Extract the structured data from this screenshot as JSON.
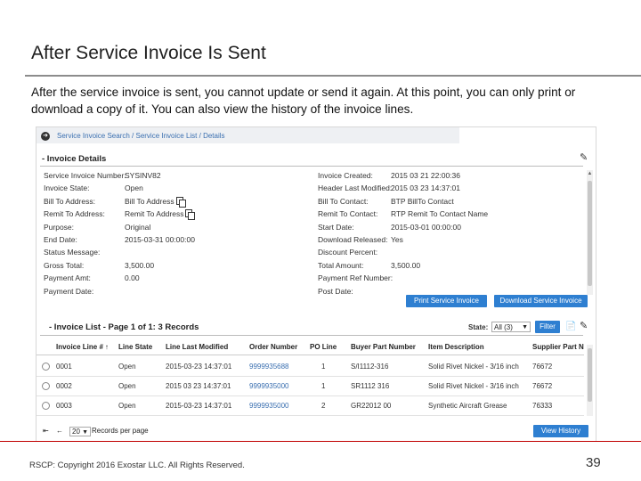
{
  "slide": {
    "title": "After Service Invoice Is Sent",
    "body": "After the service invoice is sent, you cannot update or send it again.  At this point, you can only print or download a copy of it.  You can also view the history of the invoice lines."
  },
  "app": {
    "breadcrumb": "Service Invoice Search / Service Invoice List / Details",
    "details": {
      "title": "- Invoice Details",
      "left": [
        {
          "label": "Service Invoice Number:",
          "value": "SYSINV82"
        },
        {
          "label": "Invoice State:",
          "value": "Open"
        },
        {
          "label": "Bill To Address:",
          "value": "Bill To Address"
        },
        {
          "label": "Remit To Address:",
          "value": "Remit To Address"
        },
        {
          "label": "Purpose:",
          "value": "Original"
        },
        {
          "label": "End Date:",
          "value": "2015-03-31 00:00:00"
        },
        {
          "label": "Status Message:",
          "value": ""
        },
        {
          "label": "Gross Total:",
          "value": "3,500.00"
        },
        {
          "label": "Payment Amt:",
          "value": "0.00"
        },
        {
          "label": "Payment Date:",
          "value": ""
        }
      ],
      "right": [
        {
          "label": "Invoice Created:",
          "value": "2015 03 21 22:00:36"
        },
        {
          "label": "Header Last Modified:",
          "value": "2015 03 23 14:37:01"
        },
        {
          "label": "Bill To Contact:",
          "value": "BTP BillTo Contact"
        },
        {
          "label": "Remit To Contact:",
          "value": "RTP Remit To Contact Name"
        },
        {
          "label": "Start Date:",
          "value": "2015-03-01 00:00:00"
        },
        {
          "label": "Download Released:",
          "value": "Yes"
        },
        {
          "label": "Discount Percent:",
          "value": ""
        },
        {
          "label": "Total Amount:",
          "value": "3,500.00"
        },
        {
          "label": "Payment Ref Number:",
          "value": ""
        },
        {
          "label": "Post Date:",
          "value": ""
        }
      ],
      "print_button": "Print Service Invoice",
      "download_button": "Download Service Invoice"
    },
    "list": {
      "title": "- Invoice List - Page 1 of 1: 3 Records",
      "state_label": "State:",
      "state_value": "All (3)",
      "filter_button": "Filter",
      "columns": [
        "Invoice Line #",
        "Line State",
        "Line Last Modified",
        "Order Number",
        "PO Line",
        "Buyer Part Number",
        "Item Description",
        "Supplier Part N"
      ],
      "rows": [
        {
          "line": "0001",
          "state": "Open",
          "modified": "2015-03-23 14:37:01",
          "order": "9999935688",
          "po_line": "1",
          "buyer_part": "S/I1112-316",
          "desc": "Solid Rivet Nickel - 3/16 inch",
          "supplier_part": "76672"
        },
        {
          "line": "0002",
          "state": "Open",
          "modified": "2015 03 23 14:37:01",
          "order": "9999935000",
          "po_line": "1",
          "buyer_part": "SR1112 316",
          "desc": "Solid Rivet Nickel - 3/16 inch",
          "supplier_part": "76672"
        },
        {
          "line": "0003",
          "state": "Open",
          "modified": "2015-03-23 14:37:01",
          "order": "9999935000",
          "po_line": "2",
          "buyer_part": "GR22012 00",
          "desc": "Synthetic Aircraft Grease",
          "supplier_part": "76333"
        }
      ],
      "records_per_page_value": "20",
      "records_per_page_label": "Records per page",
      "view_history_button": "View History"
    }
  },
  "footer": {
    "copyright": "RSCP:  Copyright 2016 Exostar LLC. All Rights Reserved.",
    "page_number": "39"
  },
  "colors": {
    "accent_blue": "#2e7fd1",
    "link_blue": "#3a6fb0",
    "footer_rule": "#c00000"
  }
}
